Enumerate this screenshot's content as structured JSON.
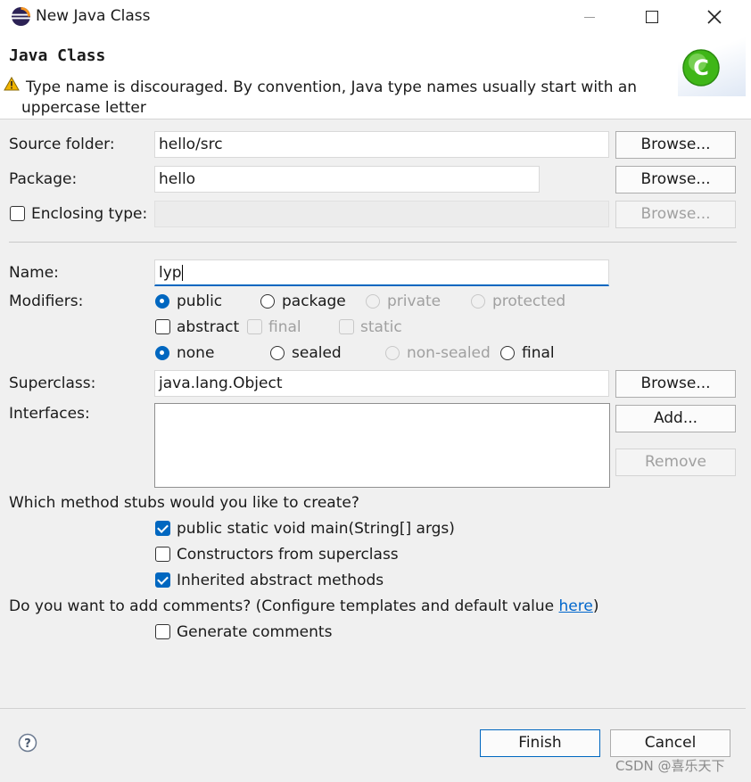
{
  "window": {
    "title": "New Java Class"
  },
  "header": {
    "title": "Java Class",
    "warning_line1": "Type name is discouraged. By convention, Java type names usually start with an",
    "warning_line2": "uppercase letter"
  },
  "form": {
    "source_folder": {
      "label": "Source folder:",
      "value": "hello/src",
      "button": "Browse..."
    },
    "package": {
      "label": "Package:",
      "value": "hello",
      "button": "Browse..."
    },
    "enclosing_type": {
      "label": "Enclosing type:",
      "value": "",
      "button": "Browse...",
      "checked": false
    },
    "name": {
      "label": "Name:",
      "value": "lyp"
    },
    "modifiers": {
      "label": "Modifiers:",
      "access": [
        "public",
        "package",
        "private",
        "protected"
      ],
      "selected_access": "public",
      "abstract": "abstract",
      "final": "final",
      "static": "static",
      "sealing": [
        "none",
        "sealed",
        "non-sealed",
        "final"
      ],
      "selected_sealing": "none"
    },
    "superclass": {
      "label": "Superclass:",
      "value": "java.lang.Object",
      "button": "Browse..."
    },
    "interfaces": {
      "label": "Interfaces:",
      "add_button": "Add...",
      "remove_button": "Remove"
    }
  },
  "stubs": {
    "question": "Which method stubs would you like to create?",
    "main": {
      "label": "public static void main(String[] args)",
      "checked": true
    },
    "constructors": {
      "label": "Constructors from superclass",
      "checked": false
    },
    "inherited": {
      "label": "Inherited abstract methods",
      "checked": true
    }
  },
  "comments": {
    "question_prefix": "Do you want to add comments? (Configure templates and default value ",
    "link": "here",
    "question_suffix": ")",
    "generate": {
      "label": "Generate comments",
      "checked": false
    }
  },
  "footer": {
    "finish": "Finish",
    "cancel": "Cancel"
  },
  "watermark": "CSDN @喜乐天下",
  "colors": {
    "accent": "#0067c0",
    "link": "#0066cc",
    "wizard_icon": "#3fb618",
    "warning": "#f0b400"
  },
  "icons": [
    "eclipse-logo-icon",
    "minimize-icon",
    "maximize-icon",
    "close-icon",
    "warning-icon",
    "java-class-wizard-icon",
    "help-icon"
  ]
}
